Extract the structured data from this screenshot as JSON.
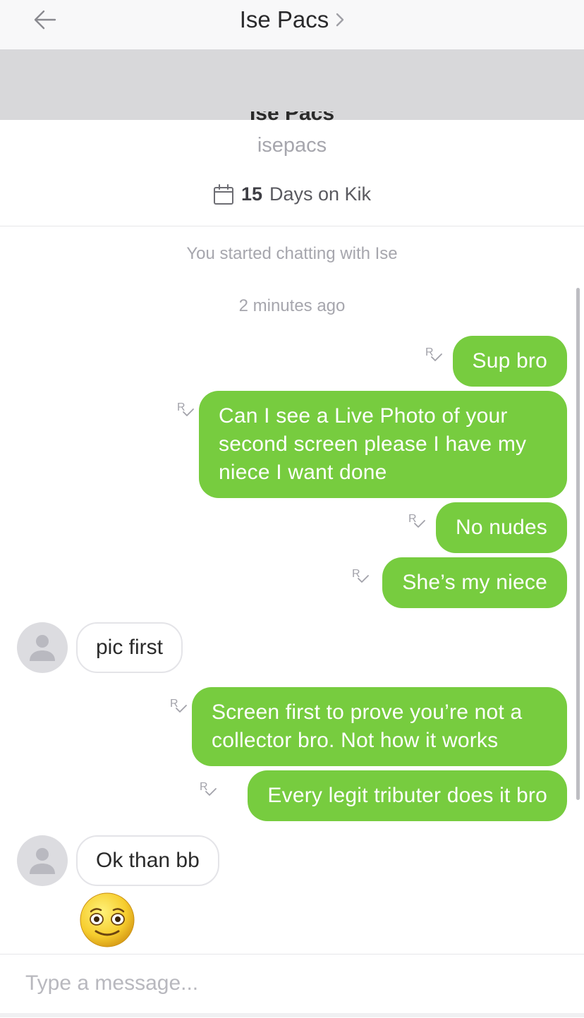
{
  "header": {
    "title": "Ise Pacs"
  },
  "profile": {
    "display_name": "Ise Pacs",
    "username": "isepacs",
    "days_count": "15",
    "days_text": "Days on Kik"
  },
  "chat": {
    "started_text": "You started chatting with Ise",
    "timestamp": "2 minutes ago",
    "read_receipt": "R",
    "messages": [
      {
        "from": "me",
        "text": "Sup bro"
      },
      {
        "from": "me",
        "text": "Can I see a Live Photo of your second screen please I have my niece I want done"
      },
      {
        "from": "me",
        "text": "No nudes"
      },
      {
        "from": "me",
        "text": "She’s my niece"
      },
      {
        "from": "them",
        "text": "pic first"
      },
      {
        "from": "me",
        "text": "Screen first to prove you’re not a collector bro. Not how it works"
      },
      {
        "from": "me",
        "text": "Every legit tributer does it bro"
      },
      {
        "from": "them",
        "text": "Ok than bb"
      },
      {
        "from": "them",
        "emoji": "flushed-smile-emoji"
      }
    ]
  },
  "compose": {
    "placeholder": "Type a message..."
  },
  "colors": {
    "outgoing_bubble": "#77cc3f",
    "incoming_border": "#e4e4e8",
    "header_bg": "#f8f8f9",
    "muted_text": "#a6a6ad"
  }
}
